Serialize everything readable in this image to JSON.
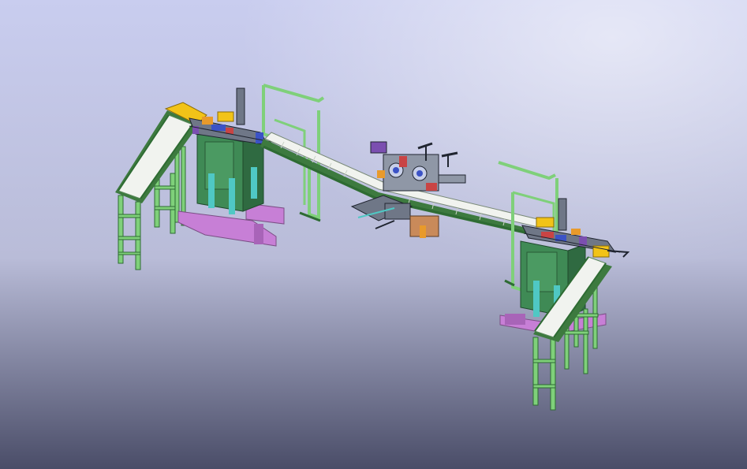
{
  "scene": {
    "kind": "isometric CAD model of an automated conveyor production line",
    "background": {
      "top": "#c9cdef",
      "middle": "#b9bcd8",
      "bottom": "#4a4d68"
    },
    "colors": {
      "frame_green": "#7fd07a",
      "frame_green_dark": "#2e6b33",
      "conveyor_belt": "#f1f3ef",
      "conveyor_edge": "#3d7a3f",
      "base_magenta": "#c77fd6",
      "cabinet_green": "#3f8a55",
      "cabinet_teal": "#4fc8c4",
      "accent_yellow": "#f2c318",
      "accent_orange": "#e89a2b",
      "accent_blue": "#3b52c6",
      "accent_red": "#c94444",
      "accent_purple": "#7b4fb0",
      "machine_gray": "#6f7787",
      "line_dark": "#202530"
    },
    "components": [
      "left-inclined-conveyor",
      "left-work-station",
      "left-gantry-frame",
      "central-sloped-conveyor",
      "center-rotary-station",
      "right-gantry-frame",
      "right-work-station",
      "right-inclined-conveyor"
    ]
  }
}
